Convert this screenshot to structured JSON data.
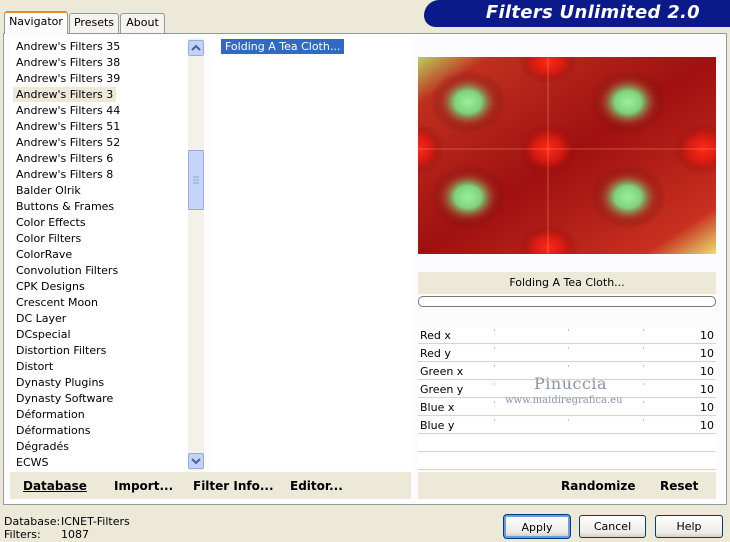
{
  "tabs": [
    {
      "label": "Navigator",
      "active": true
    },
    {
      "label": "Presets",
      "active": false
    },
    {
      "label": "About",
      "active": false
    }
  ],
  "header": {
    "title": "Filters Unlimited 2.0"
  },
  "categories": {
    "selected": "Andrew's Filters 3",
    "items": [
      "Andrew's Filters 35",
      "Andrew's Filters 38",
      "Andrew's Filters 39",
      "Andrew's Filters 3",
      "Andrew's Filters 44",
      "Andrew's Filters 51",
      "Andrew's Filters 52",
      "Andrew's Filters 6",
      "Andrew's Filters 8",
      "Balder Olrik",
      "Buttons & Frames",
      "Color Effects",
      "Color Filters",
      "ColorRave",
      "Convolution Filters",
      "CPK Designs",
      "Crescent Moon",
      "DC Layer",
      "DCspecial",
      "Distortion Filters",
      "Distort",
      "Dynasty Plugins",
      "Dynasty Software",
      "Déformation",
      "Déformations",
      "Dégradés",
      "ECWS"
    ]
  },
  "filters": {
    "items": [
      "Folding A Tea Cloth..."
    ],
    "selected": "Folding A Tea Cloth..."
  },
  "preview": {
    "filter_name": "Folding A Tea Cloth..."
  },
  "params": [
    {
      "label": "Red x",
      "value": "10"
    },
    {
      "label": "Red y",
      "value": "10"
    },
    {
      "label": "Green x",
      "value": "10"
    },
    {
      "label": "Green y",
      "value": "10"
    },
    {
      "label": "Blue x",
      "value": "10"
    },
    {
      "label": "Blue y",
      "value": "10"
    }
  ],
  "watermark": {
    "name": "Pinuccia",
    "site": "www.maidiregrafica.eu"
  },
  "toolbar": {
    "database": "Database",
    "import": "Import...",
    "filter_info": "Filter Info...",
    "editor": "Editor...",
    "randomize": "Randomize",
    "reset": "Reset"
  },
  "status": {
    "database_label": "Database:",
    "database_value": "ICNET-Filters",
    "filters_label": "Filters:",
    "filters_value": "1087"
  },
  "buttons": {
    "apply": "Apply",
    "cancel": "Cancel",
    "help": "Help"
  },
  "colors": {
    "banner": "#0A1A8A",
    "selection": "#316AC5",
    "active_tab": "#E68B2C"
  }
}
